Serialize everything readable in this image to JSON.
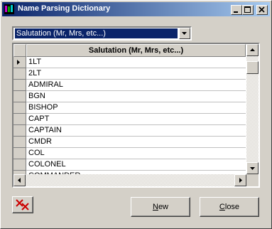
{
  "window": {
    "title": "Name Parsing Dictionary"
  },
  "category_select": {
    "value": "Salutation (Mr, Mrs, etc...)"
  },
  "grid": {
    "column_header": "Salutation (Mr, Mrs, etc...)",
    "rows": [
      "1LT",
      "2LT",
      "ADMIRAL",
      "BGN",
      "BISHOP",
      "CAPT",
      "CAPTAIN",
      "CMDR",
      "COL",
      "COLONEL",
      "COMMANDER"
    ],
    "current_row": 0
  },
  "buttons": {
    "new_label_first": "N",
    "new_label_rest": "ew",
    "close_label_first": "C",
    "close_label_rest": "lose"
  },
  "icons": {
    "delete": "delete-x-icon",
    "app": "app-icon",
    "minimize": "minimize-icon",
    "maximize": "maximize-icon",
    "close": "close-icon"
  },
  "colors": {
    "title_bar": "#0a246a",
    "selection": "#0a246a",
    "delete_icon": "#cc0000"
  }
}
